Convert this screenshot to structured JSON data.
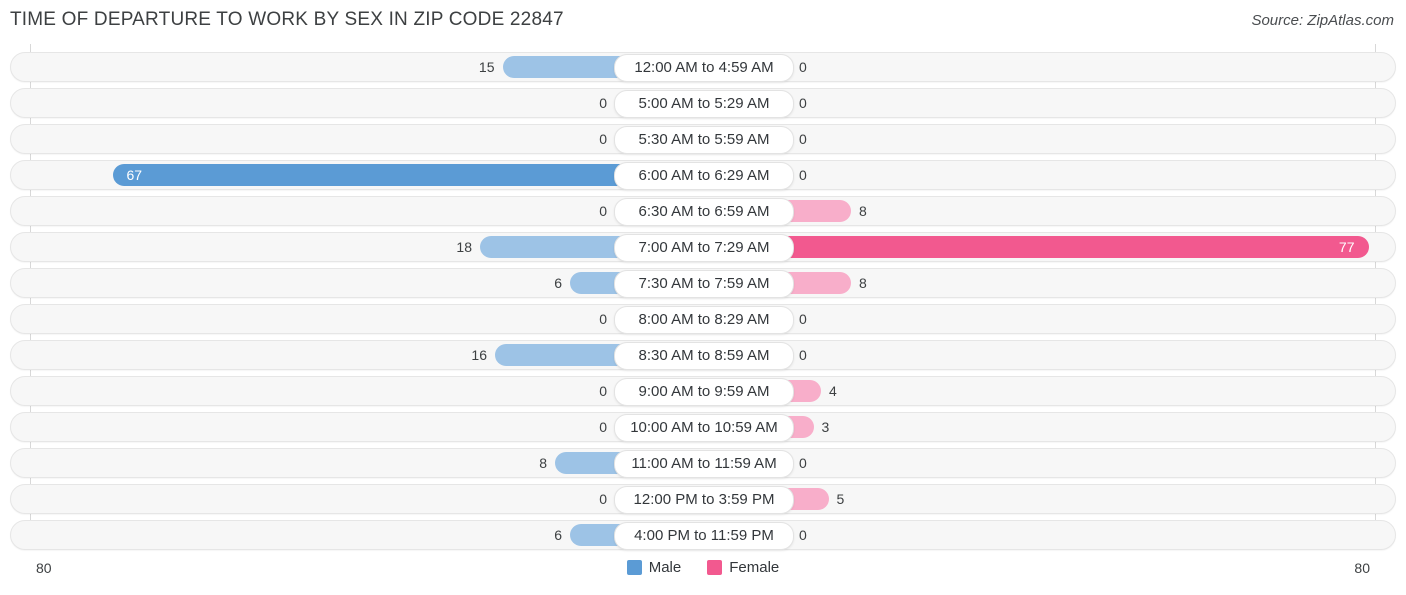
{
  "header": {
    "title": "TIME OF DEPARTURE TO WORK BY SEX IN ZIP CODE 22847",
    "source": "Source: ZipAtlas.com"
  },
  "legend": {
    "male_label": "Male",
    "female_label": "Female",
    "male_color": "#5b9bd5",
    "female_color": "#f2598f",
    "male_light_color": "#9dc3e6",
    "female_light_color": "#f8aeca"
  },
  "axis": {
    "left_label": "80",
    "right_label": "80",
    "max": 80
  },
  "chart_data": {
    "type": "bar",
    "title": "TIME OF DEPARTURE TO WORK BY SEX IN ZIP CODE 22847",
    "subtitle": "Source: ZipAtlas.com",
    "orientation": "horizontal-diverging",
    "xlabel": "",
    "ylabel": "",
    "xlim": [
      80,
      80
    ],
    "grid": true,
    "legend_position": "bottom-center",
    "categories": [
      "12:00 AM to 4:59 AM",
      "5:00 AM to 5:29 AM",
      "5:30 AM to 5:59 AM",
      "6:00 AM to 6:29 AM",
      "6:30 AM to 6:59 AM",
      "7:00 AM to 7:29 AM",
      "7:30 AM to 7:59 AM",
      "8:00 AM to 8:29 AM",
      "8:30 AM to 8:59 AM",
      "9:00 AM to 9:59 AM",
      "10:00 AM to 10:59 AM",
      "11:00 AM to 11:59 AM",
      "12:00 PM to 3:59 PM",
      "4:00 PM to 11:59 PM"
    ],
    "series": [
      {
        "name": "Male",
        "values": [
          15,
          0,
          0,
          67,
          0,
          18,
          6,
          0,
          16,
          0,
          0,
          8,
          0,
          6
        ]
      },
      {
        "name": "Female",
        "values": [
          0,
          0,
          0,
          0,
          8,
          77,
          8,
          0,
          0,
          4,
          3,
          0,
          5,
          0
        ]
      }
    ]
  },
  "rows": [
    {
      "label": "12:00 AM to 4:59 AM",
      "male": "15",
      "female": "0"
    },
    {
      "label": "5:00 AM to 5:29 AM",
      "male": "0",
      "female": "0"
    },
    {
      "label": "5:30 AM to 5:59 AM",
      "male": "0",
      "female": "0"
    },
    {
      "label": "6:00 AM to 6:29 AM",
      "male": "67",
      "female": "0"
    },
    {
      "label": "6:30 AM to 6:59 AM",
      "male": "0",
      "female": "8"
    },
    {
      "label": "7:00 AM to 7:29 AM",
      "male": "18",
      "female": "77"
    },
    {
      "label": "7:30 AM to 7:59 AM",
      "male": "6",
      "female": "8"
    },
    {
      "label": "8:00 AM to 8:29 AM",
      "male": "0",
      "female": "0"
    },
    {
      "label": "8:30 AM to 8:59 AM",
      "male": "16",
      "female": "0"
    },
    {
      "label": "9:00 AM to 9:59 AM",
      "male": "0",
      "female": "4"
    },
    {
      "label": "10:00 AM to 10:59 AM",
      "male": "0",
      "female": "3"
    },
    {
      "label": "11:00 AM to 11:59 AM",
      "male": "8",
      "female": "0"
    },
    {
      "label": "12:00 PM to 3:59 PM",
      "male": "0",
      "female": "5"
    },
    {
      "label": "4:00 PM to 11:59 PM",
      "male": "6",
      "female": "0"
    }
  ]
}
